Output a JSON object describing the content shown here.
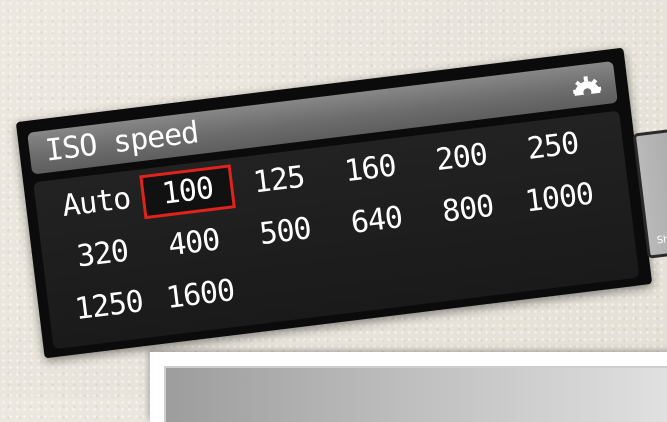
{
  "menu": {
    "title": "ISO speed",
    "settings_icon": "gear-icon",
    "selected_value": "100",
    "options": [
      "Auto",
      "100",
      "125",
      "160",
      "200",
      "250",
      "320",
      "400",
      "500",
      "640",
      "800",
      "1000",
      "1250",
      "1600"
    ]
  },
  "side_device": {
    "label": "Sh"
  },
  "colors": {
    "selection_border": "#e0241d",
    "panel": "#0b0b0b",
    "title_bar": "#7a7a7a"
  }
}
